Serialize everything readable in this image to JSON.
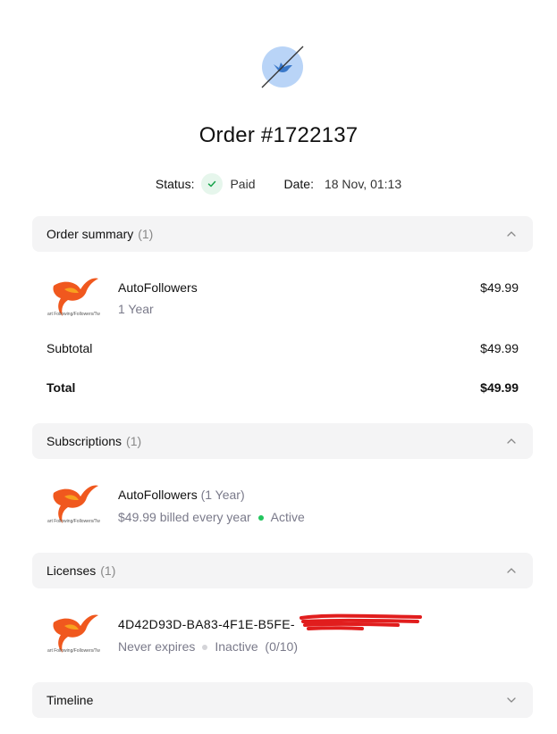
{
  "order": {
    "title": "Order #1722137",
    "status_label": "Status:",
    "status_value": "Paid",
    "date_label": "Date:",
    "date_value": "18 Nov, 01:13"
  },
  "summary": {
    "header": "Order summary",
    "count": "(1)",
    "item_name": "AutoFollowers",
    "item_period": "1 Year",
    "item_price": "$49.99",
    "thumb_caption": "art Following/Followers/Tw",
    "subtotal_label": "Subtotal",
    "subtotal_value": "$49.99",
    "total_label": "Total",
    "total_value": "$49.99"
  },
  "subscriptions": {
    "header": "Subscriptions",
    "count": "(1)",
    "name": "AutoFollowers",
    "period": "(1 Year)",
    "billing": "$49.99 billed every year",
    "status": "Active"
  },
  "licenses": {
    "header": "Licenses",
    "count": "(1)",
    "key": "4D42D93D-BA83-4F1E-B5FE-",
    "expires": "Never expires",
    "status": "Inactive",
    "activations": "(0/10)"
  },
  "timeline": {
    "header": "Timeline"
  },
  "colors": {
    "accent_blue": "#b9d4f7",
    "paid_green": "#22c55e",
    "redaction_red": "#e11d1d"
  }
}
